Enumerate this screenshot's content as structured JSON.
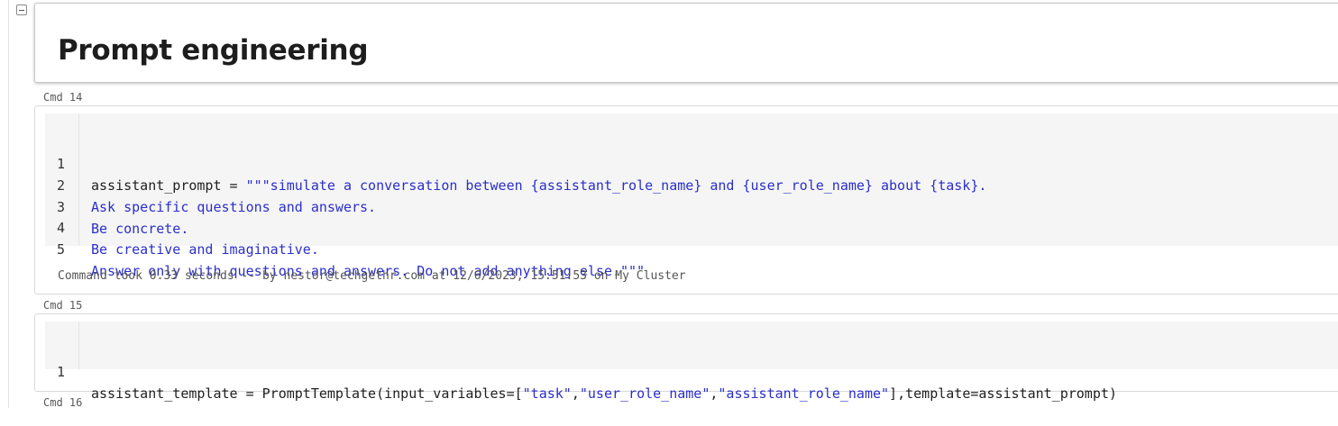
{
  "markdown_cell": {
    "title": "Prompt engineering"
  },
  "cells": [
    {
      "cmd_label": "Cmd 14",
      "lines": [
        {
          "num": "1",
          "plain": "assistant_prompt = ",
          "string": "\"\"\"simulate a conversation between {assistant_role_name} and {user_role_name} about {task}."
        },
        {
          "num": "2",
          "plain": "",
          "string": "Ask specific questions and answers."
        },
        {
          "num": "3",
          "plain": "",
          "string": "Be concrete."
        },
        {
          "num": "4",
          "plain": "",
          "string": "Be creative and imaginative."
        },
        {
          "num": "5",
          "plain": "",
          "string": "Answer only with questions and answers. Do not add anything else.\"\"\""
        }
      ],
      "status": "Command took 0.33 seconds -- by nestor@techgethr.com at 12/6/2023, 15:51:53 on My Cluster"
    },
    {
      "cmd_label": "Cmd 15",
      "line": {
        "num": "1",
        "p1": "assistant_template = PromptTemplate(input_variables=[",
        "s1": "\"task\"",
        "c1": ",",
        "s2": "\"user_role_name\"",
        "c2": ",",
        "s3": "\"assistant_role_name\"",
        "p2": "],template=assistant_prompt)"
      }
    },
    {
      "cmd_label": "Cmd 16"
    }
  ],
  "colors": {
    "string": "#2b2fc9",
    "editor_bg": "#f5f5f5"
  },
  "icons": {
    "collapse": "collapse-minus-icon"
  }
}
